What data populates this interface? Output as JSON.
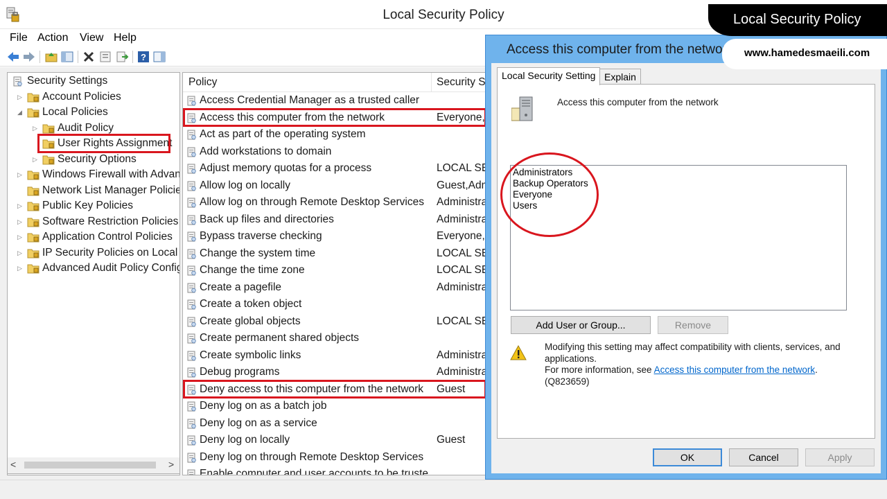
{
  "window": {
    "title": "Local Security Policy"
  },
  "menu": [
    "File",
    "Action",
    "View",
    "Help"
  ],
  "tree": {
    "items": [
      {
        "label": "Security Settings",
        "level": 0,
        "expanded": true
      },
      {
        "label": "Account Policies",
        "level": 1,
        "expanded": false
      },
      {
        "label": "Local Policies",
        "level": 1,
        "expanded": true
      },
      {
        "label": "Audit Policy",
        "level": 2,
        "expanded": false
      },
      {
        "label": "User Rights Assignment",
        "level": 2,
        "selected": true
      },
      {
        "label": "Security Options",
        "level": 2,
        "expanded": false
      },
      {
        "label": "Windows Firewall with Advan",
        "level": 1
      },
      {
        "label": "Network List Manager Policie",
        "level": 1
      },
      {
        "label": "Public Key Policies",
        "level": 1
      },
      {
        "label": "Software Restriction Policies",
        "level": 1
      },
      {
        "label": "Application Control Policies",
        "level": 1
      },
      {
        "label": "IP Security Policies on Local C",
        "level": 1
      },
      {
        "label": "Advanced Audit Policy Config",
        "level": 1
      }
    ],
    "scroll_left": "<",
    "scroll_right": ">"
  },
  "list": {
    "columns": {
      "policy": "Policy",
      "setting": "Security Se"
    },
    "rows": [
      {
        "policy": "Access Credential Manager as a trusted caller",
        "setting": ""
      },
      {
        "policy": "Access this computer from the network",
        "setting": "Everyone,A"
      },
      {
        "policy": "Act as part of the operating system",
        "setting": ""
      },
      {
        "policy": "Add workstations to domain",
        "setting": ""
      },
      {
        "policy": "Adjust memory quotas for a process",
        "setting": "LOCAL SER"
      },
      {
        "policy": "Allow log on locally",
        "setting": "Guest,Adm"
      },
      {
        "policy": "Allow log on through Remote Desktop Services",
        "setting": "Administra"
      },
      {
        "policy": "Back up files and directories",
        "setting": "Administra"
      },
      {
        "policy": "Bypass traverse checking",
        "setting": "Everyone,L"
      },
      {
        "policy": "Change the system time",
        "setting": "LOCAL SER"
      },
      {
        "policy": "Change the time zone",
        "setting": "LOCAL SER"
      },
      {
        "policy": "Create a pagefile",
        "setting": "Administra"
      },
      {
        "policy": "Create a token object",
        "setting": ""
      },
      {
        "policy": "Create global objects",
        "setting": "LOCAL SER"
      },
      {
        "policy": "Create permanent shared objects",
        "setting": ""
      },
      {
        "policy": "Create symbolic links",
        "setting": "Administra"
      },
      {
        "policy": "Debug programs",
        "setting": "Administra"
      },
      {
        "policy": "Deny access to this computer from the network",
        "setting": "Guest"
      },
      {
        "policy": "Deny log on as a batch job",
        "setting": ""
      },
      {
        "policy": "Deny log on as a service",
        "setting": ""
      },
      {
        "policy": "Deny log on locally",
        "setting": "Guest"
      },
      {
        "policy": "Deny log on through Remote Desktop Services",
        "setting": ""
      },
      {
        "policy": "Enable computer and user accounts to be truste",
        "setting": ""
      }
    ]
  },
  "dialog": {
    "title": "Access this computer from the network Properties",
    "tabs": [
      "Local Security Setting",
      "Explain"
    ],
    "active_tab": 0,
    "policy_name": "Access this computer from the network",
    "members": [
      "Administrators",
      "Backup Operators",
      "Everyone",
      "Users"
    ],
    "buttons": {
      "add": "Add User or Group...",
      "remove": "Remove",
      "ok": "OK",
      "cancel": "Cancel",
      "apply": "Apply"
    },
    "warning": {
      "line1": "Modifying this setting may affect compatibility with clients, services, and applications.",
      "more_prefix": "For more information, see ",
      "link": "Access this computer from the network",
      "more_suffix": ".",
      "kb": "(Q823659)"
    }
  },
  "overlay": {
    "banner_title": "Local Security Policy",
    "website": "www.hamedesmaeili.com"
  },
  "colors": {
    "highlight_red": "#d9161e",
    "dialog_frame": "#6fb3ec",
    "link_blue": "#0066cc"
  }
}
